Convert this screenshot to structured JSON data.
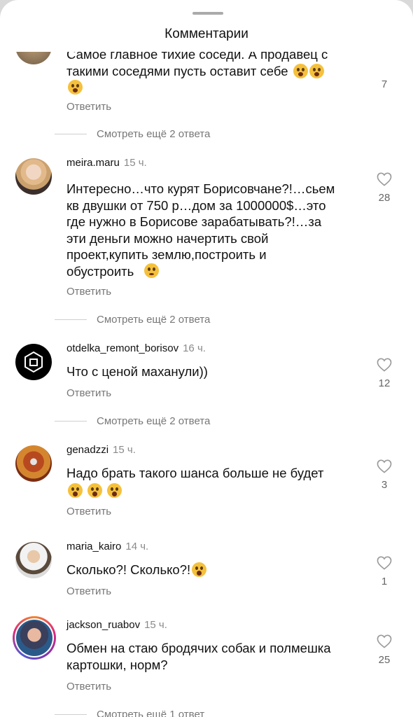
{
  "header": {
    "title": "Комментарии"
  },
  "partial": {
    "text_line1": "Самое главное тихие соседи. А продавец с",
    "text_line2": "такими соседями пусть оставит себе",
    "likes": "7",
    "reply_label": "Ответить",
    "more_label": "Смотреть ещё 2 ответа"
  },
  "comments": [
    {
      "username": "meira.maru",
      "time": "15 ч.",
      "text": "Интересно…что курят Борисовчане?!…сьем\nкв двушки от 750 р…дом за 1000000$…это\nгде нужно в Борисове зарабатывать?!…за\nэти деньги можно начертить свой\nпроект,купить землю,построить и\nобустроить",
      "likes": "28",
      "reply_label": "Ответить",
      "more_label": "Смотреть ещё 2 ответа",
      "avatar": "woman-blonde-avatar"
    },
    {
      "username": "otdelka_remont_borisov",
      "time": "16 ч.",
      "text": "Что с ценой маханули))",
      "likes": "12",
      "reply_label": "Ответить",
      "more_label": "Смотреть ещё 2 ответа",
      "avatar": "logo-avatar"
    },
    {
      "username": "genadzzi",
      "time": "15 ч.",
      "text": "Надо брать такого шанса больше не будет",
      "likes": "3",
      "reply_label": "Ответить",
      "avatar": "man-chair-avatar"
    },
    {
      "username": "maria_kairo",
      "time": "14 ч.",
      "text": "Сколько?! Сколько?!",
      "likes": "1",
      "reply_label": "Ответить",
      "avatar": "woman-winter-avatar"
    },
    {
      "username": "jackson_ruabov",
      "time": "15 ч.",
      "text": "Обмен на стаю бродячих собак и полмешка\nкартошки, норм?",
      "likes": "25",
      "reply_label": "Ответить",
      "more_label": "Смотреть ещё 1 ответ",
      "avatar": "man-portrait-avatar"
    }
  ],
  "colors": {
    "text": "#111111",
    "muted": "#777777",
    "heart": "#9a9a9a",
    "story_ring": "#e1306c"
  }
}
